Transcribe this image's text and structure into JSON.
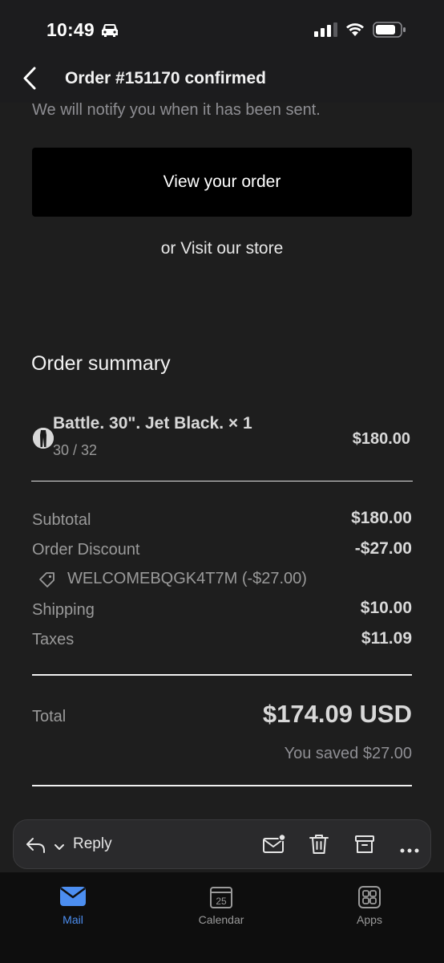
{
  "status_bar": {
    "time": "10:49"
  },
  "header": {
    "title": "Order #151170 confirmed"
  },
  "email": {
    "notify_text": "We will notify you when it has been sent.",
    "view_order_label": "View your order",
    "visit_store_prefix": "or ",
    "visit_store_link": "Visit our store",
    "summary_title": "Order summary",
    "item": {
      "name": "Battle. 30\". Jet Black. × 1",
      "variant": "30 / 32",
      "price": "$180.00"
    },
    "totals": {
      "subtotal_label": "Subtotal",
      "subtotal_value": "$180.00",
      "discount_label": "Order Discount",
      "discount_value": "-$27.00",
      "discount_code": "WELCOMEBQGK4T7M (-$27.00)",
      "shipping_label": "Shipping",
      "shipping_value": "$10.00",
      "taxes_label": "Taxes",
      "taxes_value": "$11.09",
      "total_label": "Total",
      "total_value": "$174.09 USD",
      "saved_text": "You saved $27.00"
    }
  },
  "action_bar": {
    "reply_label": "Reply"
  },
  "tabs": [
    {
      "label": "Mail",
      "icon": "mail-icon",
      "active": true
    },
    {
      "label": "Calendar",
      "icon": "calendar-icon",
      "calendar_day": "25"
    },
    {
      "label": "Apps",
      "icon": "apps-icon"
    }
  ],
  "colors": {
    "accent": "#4c8ef0",
    "background": "#1e1e1e",
    "button": "#000000"
  }
}
